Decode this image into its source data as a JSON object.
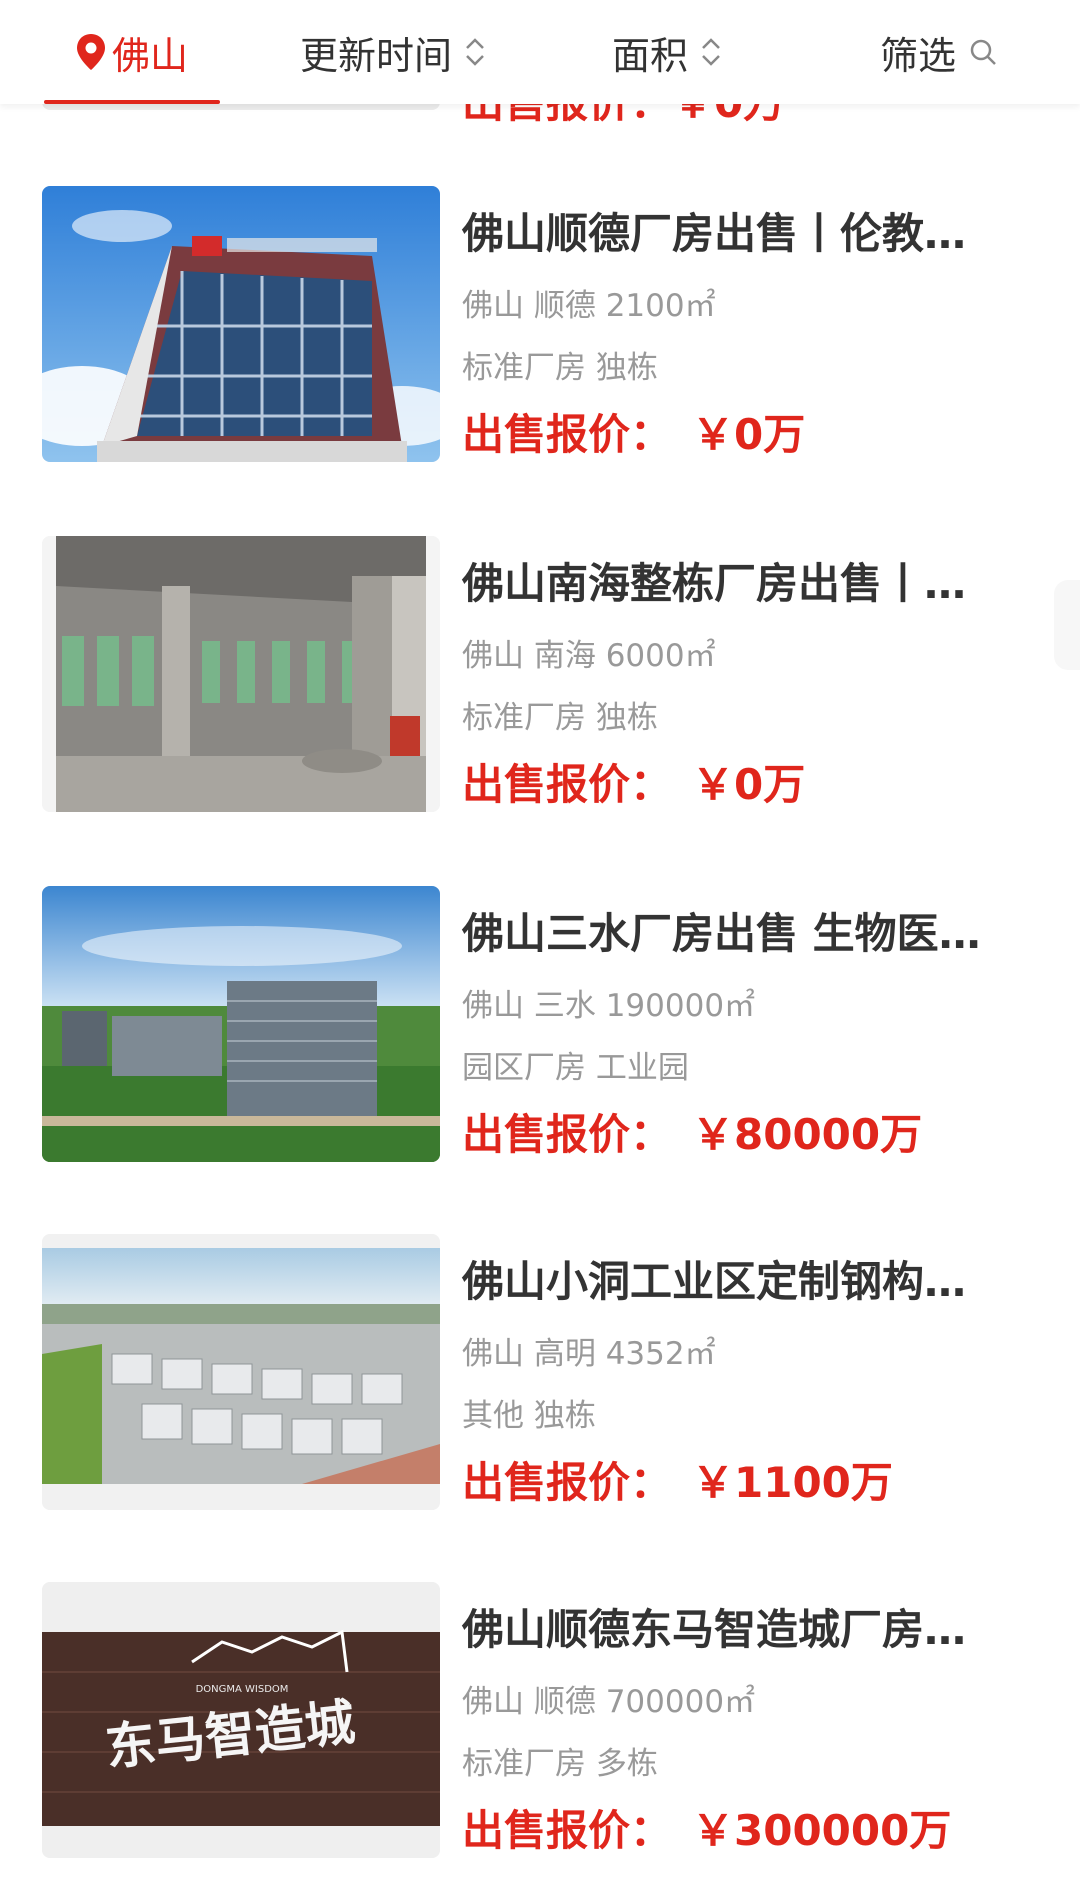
{
  "filter_bar": {
    "city": "佛山",
    "update_time": "更新时间",
    "area": "面积",
    "filter": "筛选"
  },
  "partial_top_price": "出售报价：￥0万",
  "listings": [
    {
      "title": "佛山顺德厂房出售丨伦教…",
      "location": "佛山 顺德 2100㎡",
      "tags": "标准厂房 独栋",
      "price_label": "出售报价：",
      "price_value": "￥0万"
    },
    {
      "title": "佛山南海整栋厂房出售丨…",
      "location": "佛山 南海 6000㎡",
      "tags": "标准厂房 独栋",
      "price_label": "出售报价：",
      "price_value": "￥0万"
    },
    {
      "title": "佛山三水厂房出售 生物医…",
      "location": "佛山 三水 190000㎡",
      "tags": "园区厂房 工业园",
      "price_label": "出售报价：",
      "price_value": "￥80000万"
    },
    {
      "title": "佛山小洞工业区定制钢构…",
      "location": "佛山 高明 4352㎡",
      "tags": "其他 独栋",
      "price_label": "出售报价：",
      "price_value": "￥1100万"
    },
    {
      "title": "佛山顺德东马智造城厂房…",
      "location": "佛山 顺德 700000㎡",
      "tags": "标准厂房 多栋",
      "price_label": "出售报价：",
      "price_value": "￥300000万"
    }
  ],
  "images": {
    "listing_5_sign": "东马智造城",
    "listing_5_sign_sub": "DONGMA WISDOM"
  },
  "colors": {
    "accent": "#e0261c",
    "title": "#333333",
    "meta": "#999999"
  }
}
